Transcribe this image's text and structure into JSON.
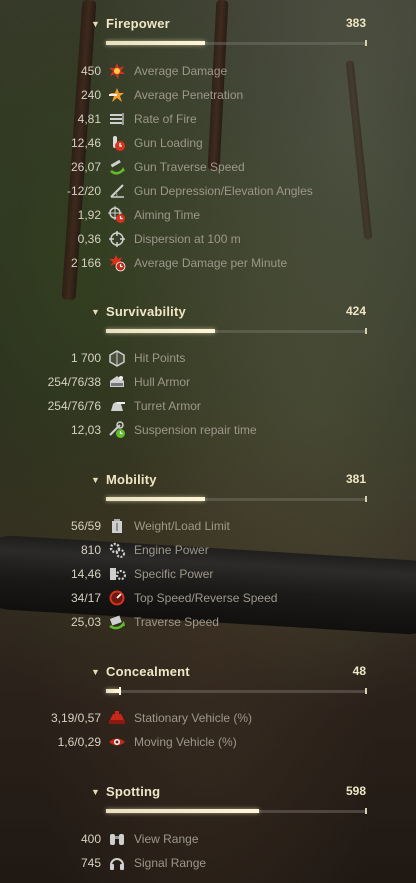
{
  "sections": [
    {
      "title": "Firepower",
      "value": "383",
      "fill": 0.38,
      "rows": [
        {
          "value": "450",
          "label": "Average Damage",
          "icon": "explosion-icon"
        },
        {
          "value": "240",
          "label": "Average Penetration",
          "icon": "penetration-icon"
        },
        {
          "value": "4,81",
          "label": "Rate of Fire",
          "icon": "rate-of-fire-icon"
        },
        {
          "value": "12,46",
          "label": "Gun Loading",
          "icon": "shell-loading-icon"
        },
        {
          "value": "26,07",
          "label": "Gun Traverse Speed",
          "icon": "gun-traverse-icon"
        },
        {
          "value": "-12/20",
          "label": "Gun Depression/Elevation Angles",
          "icon": "gun-angles-icon"
        },
        {
          "value": "1,92",
          "label": "Aiming Time",
          "icon": "aiming-time-icon"
        },
        {
          "value": "0,36",
          "label": "Dispersion at 100 m",
          "icon": "crosshair-icon"
        },
        {
          "value": "2 166",
          "label": "Average Damage per Minute",
          "icon": "damage-per-minute-icon"
        }
      ]
    },
    {
      "title": "Survivability",
      "value": "424",
      "fill": 0.42,
      "rows": [
        {
          "value": "1 700",
          "label": "Hit Points",
          "icon": "hit-points-icon"
        },
        {
          "value": "254/76/38",
          "label": "Hull Armor",
          "icon": "hull-armor-icon"
        },
        {
          "value": "254/76/76",
          "label": "Turret Armor",
          "icon": "turret-armor-icon"
        },
        {
          "value": "12,03",
          "label": "Suspension repair time",
          "icon": "suspension-repair-icon"
        }
      ]
    },
    {
      "title": "Mobility",
      "value": "381",
      "fill": 0.38,
      "rows": [
        {
          "value": "56/59",
          "label": "Weight/Load Limit",
          "icon": "weight-icon"
        },
        {
          "value": "810",
          "label": "Engine Power",
          "icon": "engine-icon"
        },
        {
          "value": "14,46",
          "label": "Specific Power",
          "icon": "specific-power-icon"
        },
        {
          "value": "34/17",
          "label": "Top Speed/Reverse Speed",
          "icon": "speedometer-icon"
        },
        {
          "value": "25,03",
          "label": "Traverse Speed",
          "icon": "hull-traverse-icon"
        }
      ]
    },
    {
      "title": "Concealment",
      "value": "48",
      "fill": 0.05,
      "rows": [
        {
          "value": "3,19/0,57",
          "label": "Stationary Vehicle (%)",
          "icon": "stationary-camo-icon"
        },
        {
          "value": "1,6/0,29",
          "label": "Moving Vehicle (%)",
          "icon": "moving-camo-icon"
        }
      ]
    },
    {
      "title": "Spotting",
      "value": "598",
      "fill": 0.59,
      "rows": [
        {
          "value": "400",
          "label": "View Range",
          "icon": "binoculars-icon"
        },
        {
          "value": "745",
          "label": "Signal Range",
          "icon": "radio-icon"
        }
      ]
    }
  ],
  "colors": {
    "title": "#efe6c6",
    "value": "#d6d1c0",
    "label": "#9d988a",
    "accent_red": "#d8321e",
    "accent_green": "#5fbf2a"
  }
}
